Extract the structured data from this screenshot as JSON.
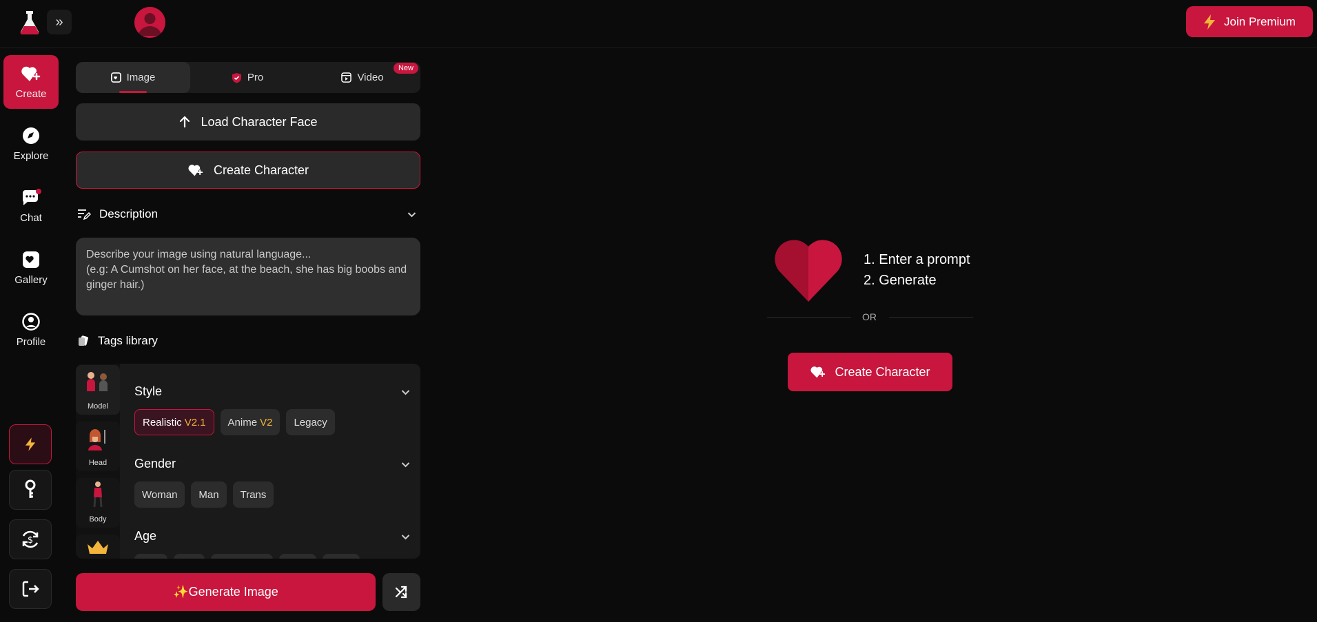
{
  "header": {
    "premium_label": "Join Premium"
  },
  "sidebar": {
    "items": [
      {
        "label": "Create"
      },
      {
        "label": "Explore"
      },
      {
        "label": "Chat"
      },
      {
        "label": "Gallery"
      },
      {
        "label": "Profile"
      }
    ]
  },
  "tabs": [
    {
      "label": "Image"
    },
    {
      "label": "Pro"
    },
    {
      "label": "Video"
    }
  ],
  "video_badge": "New",
  "panel": {
    "load_face_label": "Load Character Face",
    "create_character_label": "Create Character",
    "description_title": "Description",
    "description_placeholder_line1": "Describe your image using natural language...",
    "description_placeholder_line2": "(e.g: A Cumshot on her face, at the beach, she has big boobs and ginger hair.)",
    "tags_title": "Tags library"
  },
  "tags": {
    "thumbs": [
      {
        "label": "Model"
      },
      {
        "label": "Head"
      },
      {
        "label": "Body"
      }
    ],
    "style": {
      "title": "Style",
      "chips": [
        {
          "label": "Realistic",
          "version": "V2.1"
        },
        {
          "label": "Anime",
          "version": "V2"
        },
        {
          "label": "Legacy",
          "version": ""
        }
      ]
    },
    "gender": {
      "title": "Gender",
      "chips": [
        "Woman",
        "Man",
        "Trans"
      ]
    },
    "age": {
      "title": "Age"
    }
  },
  "generate_label": "✨Generate Image",
  "main": {
    "step1": "1. Enter a prompt",
    "step2": "2. Generate",
    "or_text": "OR",
    "create_character_label": "Create Character"
  },
  "colors": {
    "accent": "#c8163e",
    "background": "#0b0b0b",
    "version_highlight": "#f2b43a"
  }
}
